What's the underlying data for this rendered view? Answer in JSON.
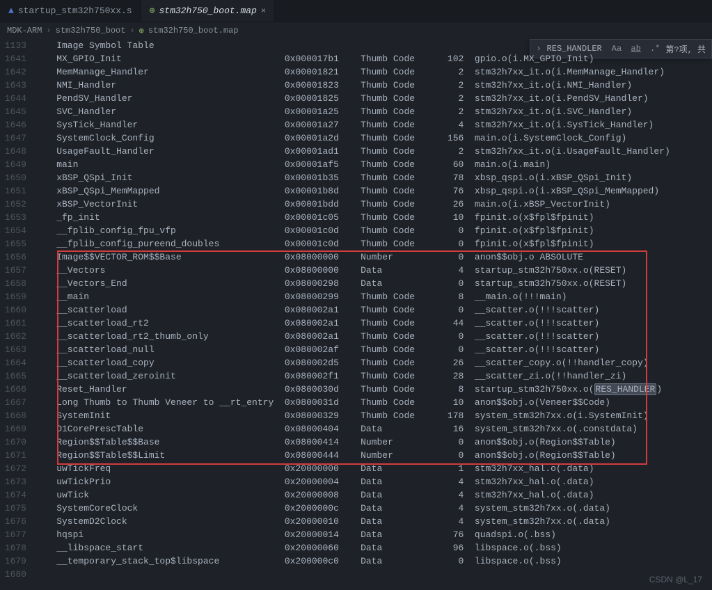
{
  "tabs": [
    {
      "icon": "▲",
      "iconClass": "icon-blue",
      "label": "startup_stm32h750xx.s",
      "active": false
    },
    {
      "icon": "⊕",
      "iconClass": "icon-green",
      "label": "stm32h750_boot.map",
      "active": true
    }
  ],
  "breadcrumbs": {
    "p0": "MDK-ARM",
    "p1": "stm32h750_boot",
    "p2": "stm32h750_boot.map",
    "icon": "⊕"
  },
  "find": {
    "chev": "›",
    "value": "RES_HANDLER",
    "opt_case": "Aa",
    "opt_word": "ab",
    "opt_regex": ".*",
    "hint": "第?项, 共"
  },
  "header_line": {
    "ln": "1133",
    "txt": "    Image Symbol Table"
  },
  "rows": [
    {
      "ln": "1641",
      "name": "MX_GPIO_Init",
      "addr": "0x000017b1",
      "type": "Thumb Code",
      "size": "102",
      "obj": "gpio.o(i.MX_GPIO_Init)"
    },
    {
      "ln": "1642",
      "name": "MemManage_Handler",
      "addr": "0x00001821",
      "type": "Thumb Code",
      "size": "2",
      "obj": "stm32h7xx_it.o(i.MemManage_Handler)"
    },
    {
      "ln": "1643",
      "name": "NMI_Handler",
      "addr": "0x00001823",
      "type": "Thumb Code",
      "size": "2",
      "obj": "stm32h7xx_it.o(i.NMI_Handler)"
    },
    {
      "ln": "1644",
      "name": "PendSV_Handler",
      "addr": "0x00001825",
      "type": "Thumb Code",
      "size": "2",
      "obj": "stm32h7xx_it.o(i.PendSV_Handler)"
    },
    {
      "ln": "1645",
      "name": "SVC_Handler",
      "addr": "0x00001a25",
      "type": "Thumb Code",
      "size": "2",
      "obj": "stm32h7xx_it.o(i.SVC_Handler)"
    },
    {
      "ln": "1646",
      "name": "SysTick_Handler",
      "addr": "0x00001a27",
      "type": "Thumb Code",
      "size": "4",
      "obj": "stm32h7xx_it.o(i.SysTick_Handler)"
    },
    {
      "ln": "1647",
      "name": "SystemClock_Config",
      "addr": "0x00001a2d",
      "type": "Thumb Code",
      "size": "156",
      "obj": "main.o(i.SystemClock_Config)"
    },
    {
      "ln": "1648",
      "name": "UsageFault_Handler",
      "addr": "0x00001ad1",
      "type": "Thumb Code",
      "size": "2",
      "obj": "stm32h7xx_it.o(i.UsageFault_Handler)"
    },
    {
      "ln": "1649",
      "name": "main",
      "addr": "0x00001af5",
      "type": "Thumb Code",
      "size": "60",
      "obj": "main.o(i.main)"
    },
    {
      "ln": "1650",
      "name": "xBSP_QSpi_Init",
      "addr": "0x00001b35",
      "type": "Thumb Code",
      "size": "78",
      "obj": "xbsp_qspi.o(i.xBSP_QSpi_Init)"
    },
    {
      "ln": "1651",
      "name": "xBSP_QSpi_MemMapped",
      "addr": "0x00001b8d",
      "type": "Thumb Code",
      "size": "76",
      "obj": "xbsp_qspi.o(i.xBSP_QSpi_MemMapped)"
    },
    {
      "ln": "1652",
      "name": "xBSP_VectorInit",
      "addr": "0x00001bdd",
      "type": "Thumb Code",
      "size": "26",
      "obj": "main.o(i.xBSP_VectorInit)"
    },
    {
      "ln": "1653",
      "name": "_fp_init",
      "addr": "0x00001c05",
      "type": "Thumb Code",
      "size": "10",
      "obj": "fpinit.o(x$fpl$fpinit)"
    },
    {
      "ln": "1654",
      "name": "__fplib_config_fpu_vfp",
      "addr": "0x00001c0d",
      "type": "Thumb Code",
      "size": "0",
      "obj": "fpinit.o(x$fpl$fpinit)"
    },
    {
      "ln": "1655",
      "name": "__fplib_config_pureend_doubles",
      "addr": "0x00001c0d",
      "type": "Thumb Code",
      "size": "0",
      "obj": "fpinit.o(x$fpl$fpinit)"
    },
    {
      "ln": "1656",
      "name": "Image$$VECTOR_ROM$$Base",
      "addr": "0x08000000",
      "type": "Number",
      "size": "0",
      "obj": "anon$$obj.o ABSOLUTE",
      "hl": true
    },
    {
      "ln": "1657",
      "name": "__Vectors",
      "addr": "0x08000000",
      "type": "Data",
      "size": "4",
      "obj": "startup_stm32h750xx.o(RESET)",
      "hl": true
    },
    {
      "ln": "1658",
      "name": "__Vectors_End",
      "addr": "0x08000298",
      "type": "Data",
      "size": "0",
      "obj": "startup_stm32h750xx.o(RESET)",
      "hl": true
    },
    {
      "ln": "1659",
      "name": "__main",
      "addr": "0x08000299",
      "type": "Thumb Code",
      "size": "8",
      "obj": "__main.o(!!!main)",
      "hl": true
    },
    {
      "ln": "1660",
      "name": "__scatterload",
      "addr": "0x080002a1",
      "type": "Thumb Code",
      "size": "0",
      "obj": "__scatter.o(!!!scatter)",
      "hl": true
    },
    {
      "ln": "1661",
      "name": "__scatterload_rt2",
      "addr": "0x080002a1",
      "type": "Thumb Code",
      "size": "44",
      "obj": "__scatter.o(!!!scatter)",
      "hl": true
    },
    {
      "ln": "1662",
      "name": "__scatterload_rt2_thumb_only",
      "addr": "0x080002a1",
      "type": "Thumb Code",
      "size": "0",
      "obj": "__scatter.o(!!!scatter)",
      "hl": true
    },
    {
      "ln": "1663",
      "name": "__scatterload_null",
      "addr": "0x080002af",
      "type": "Thumb Code",
      "size": "0",
      "obj": "__scatter.o(!!!scatter)",
      "hl": true
    },
    {
      "ln": "1664",
      "name": "__scatterload_copy",
      "addr": "0x080002d5",
      "type": "Thumb Code",
      "size": "26",
      "obj": "__scatter_copy.o(!!handler_copy)",
      "hl": true
    },
    {
      "ln": "1665",
      "name": "__scatterload_zeroinit",
      "addr": "0x080002f1",
      "type": "Thumb Code",
      "size": "28",
      "obj": "__scatter_zi.o(!!handler_zi)",
      "hl": true
    },
    {
      "ln": "1666",
      "name": "Reset_Handler",
      "addr": "0x0800030d",
      "type": "Thumb Code",
      "size": "8",
      "obj": "startup_stm32h750xx.o(",
      "obj_hl": "RES_HANDLER",
      "obj_after": ")",
      "hl": true
    },
    {
      "ln": "1667",
      "name": "Long Thumb to Thumb Veneer to __rt_entry",
      "addr": "0x0800031d",
      "type": "Thumb Code",
      "size": "10",
      "obj": "anon$$obj.o(Veneer$$Code)",
      "hl": true
    },
    {
      "ln": "1668",
      "name": "SystemInit",
      "addr": "0x08000329",
      "type": "Thumb Code",
      "size": "178",
      "obj": "system_stm32h7xx.o(i.SystemInit)",
      "hl": true
    },
    {
      "ln": "1669",
      "name": "D1CorePrescTable",
      "addr": "0x08000404",
      "type": "Data",
      "size": "16",
      "obj": "system_stm32h7xx.o(.constdata)",
      "hl": true
    },
    {
      "ln": "1670",
      "name": "Region$$Table$$Base",
      "addr": "0x08000414",
      "type": "Number",
      "size": "0",
      "obj": "anon$$obj.o(Region$$Table)",
      "hl": true
    },
    {
      "ln": "1671",
      "name": "Region$$Table$$Limit",
      "addr": "0x08000444",
      "type": "Number",
      "size": "0",
      "obj": "anon$$obj.o(Region$$Table)",
      "hl": true
    },
    {
      "ln": "1672",
      "name": "uwTickFreq",
      "addr": "0x20000000",
      "type": "Data",
      "size": "1",
      "obj": "stm32h7xx_hal.o(.data)"
    },
    {
      "ln": "1673",
      "name": "uwTickPrio",
      "addr": "0x20000004",
      "type": "Data",
      "size": "4",
      "obj": "stm32h7xx_hal.o(.data)"
    },
    {
      "ln": "1674",
      "name": "uwTick",
      "addr": "0x20000008",
      "type": "Data",
      "size": "4",
      "obj": "stm32h7xx_hal.o(.data)"
    },
    {
      "ln": "1675",
      "name": "SystemCoreClock",
      "addr": "0x2000000c",
      "type": "Data",
      "size": "4",
      "obj": "system_stm32h7xx.o(.data)"
    },
    {
      "ln": "1676",
      "name": "SystemD2Clock",
      "addr": "0x20000010",
      "type": "Data",
      "size": "4",
      "obj": "system_stm32h7xx.o(.data)"
    },
    {
      "ln": "1677",
      "name": "hqspi",
      "addr": "0x20000014",
      "type": "Data",
      "size": "76",
      "obj": "quadspi.o(.bss)"
    },
    {
      "ln": "1678",
      "name": "__libspace_start",
      "addr": "0x20000060",
      "type": "Data",
      "size": "96",
      "obj": "libspace.o(.bss)"
    },
    {
      "ln": "1679",
      "name": "__temporary_stack_top$libspace",
      "addr": "0x200000c0",
      "type": "Data",
      "size": "0",
      "obj": "libspace.o(.bss)"
    },
    {
      "ln": "1680",
      "name": "",
      "addr": "",
      "type": "",
      "size": "",
      "obj": ""
    }
  ],
  "columns": {
    "name_w": 42,
    "addr_w": 14,
    "type_w": 13,
    "size_w": 6
  },
  "watermark": "CSDN @L_17"
}
